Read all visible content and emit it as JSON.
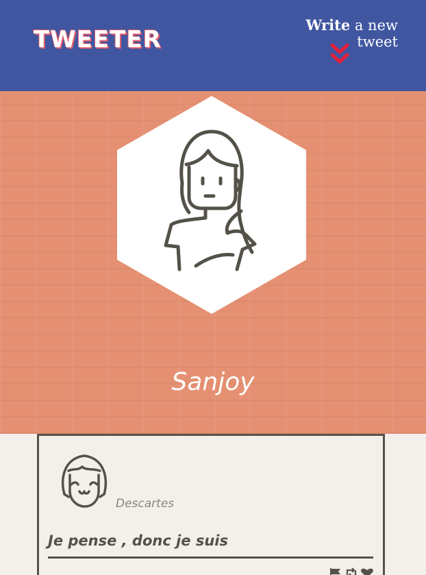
{
  "navbar": {
    "brand": "TWEETER",
    "compose": {
      "bold_word": "Write",
      "rest": " a new tweet"
    },
    "icon": "double-chevron-down-icon"
  },
  "profile": {
    "name": "Sanjoy",
    "avatar_icon": "woman-avatar-icon"
  },
  "tweet": {
    "avatar_icon": "girl-avatar-icon",
    "author": "Descartes",
    "text": "Je pense , donc je suis",
    "actions": [
      "flag-icon",
      "retweet-icon",
      "heart-icon"
    ]
  },
  "colors": {
    "navbar_bg": "#4056a1",
    "accent_red": "#e3213a",
    "hero_bg": "#e59072",
    "card_border": "#545149",
    "page_bg": "#f3f0eb"
  }
}
